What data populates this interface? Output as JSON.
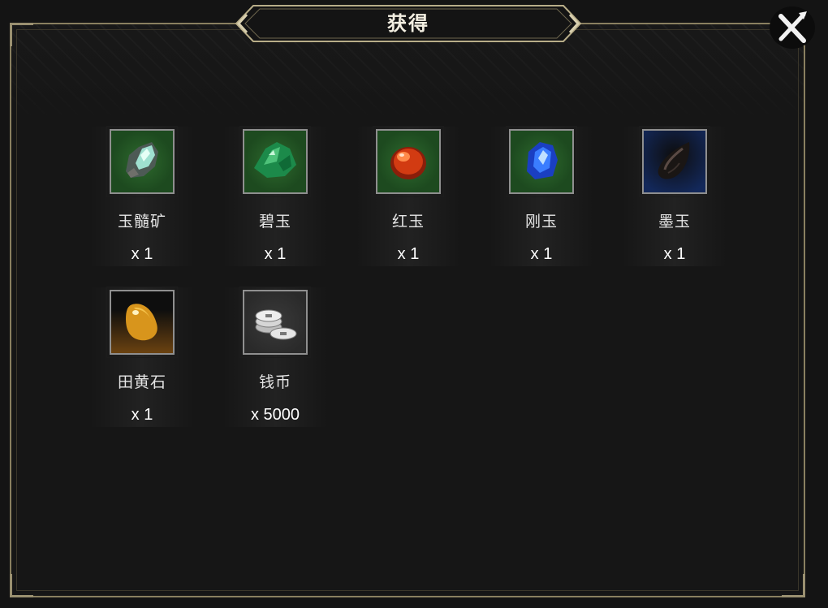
{
  "dialog": {
    "title": "获得"
  },
  "colors": {
    "frame_gold": "#8a8060",
    "panel_bg": "#161616",
    "text": "#e6e6e6"
  },
  "items": [
    {
      "name": "玉髓矿",
      "count": "x 1",
      "icon": "chalcedony-ore-icon",
      "rarity_bg": "#1d4a1f"
    },
    {
      "name": "碧玉",
      "count": "x 1",
      "icon": "jasper-icon",
      "rarity_bg": "#1d4a1f"
    },
    {
      "name": "红玉",
      "count": "x 1",
      "icon": "ruby-icon",
      "rarity_bg": "#1d4a1f"
    },
    {
      "name": "刚玉",
      "count": "x 1",
      "icon": "corundum-icon",
      "rarity_bg": "#1d4a1f"
    },
    {
      "name": "墨玉",
      "count": "x 1",
      "icon": "black-jade-icon",
      "rarity_bg": "#13285a"
    },
    {
      "name": "田黄石",
      "count": "x 1",
      "icon": "tianhuang-stone-icon",
      "rarity_bg": "#6b4210"
    },
    {
      "name": "钱币",
      "count": "x 5000",
      "icon": "coins-icon",
      "rarity_bg": "#2a2a2a"
    }
  ]
}
